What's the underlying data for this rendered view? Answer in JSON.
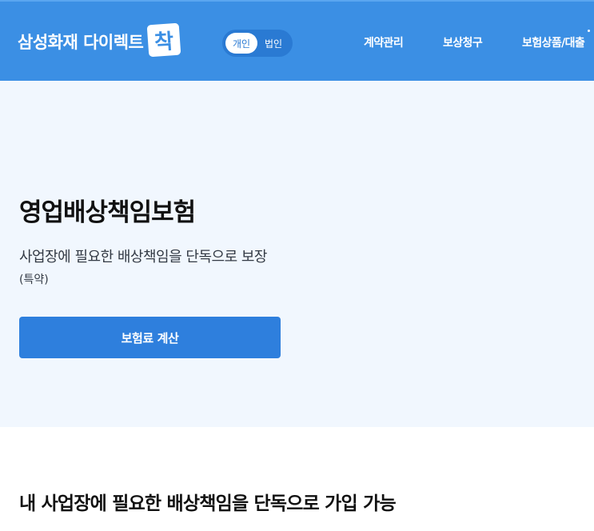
{
  "header": {
    "logo_text": "삼성화재 다이렉트",
    "logo_badge": "착",
    "toggle": {
      "personal": "개인",
      "corporate": "법인",
      "selected": "개인"
    },
    "nav": {
      "contract": "계약관리",
      "claims": "보상청구",
      "products": "보험상품/대출"
    }
  },
  "hero": {
    "title": "영업배상책임보험",
    "subtitle": "사업장에 필요한 배상책임을 단독으로 보장",
    "note": "(특약)",
    "cta": "보험료 계산"
  },
  "section": {
    "title": "내 사업장에 필요한 배상책임을 단독으로 가입 가능"
  },
  "colors": {
    "header_bg": "#3b8fe4",
    "hero_bg": "#f1f7fe",
    "button_bg": "#2e7fdd",
    "toggle_bg": "#2a7ad3"
  }
}
